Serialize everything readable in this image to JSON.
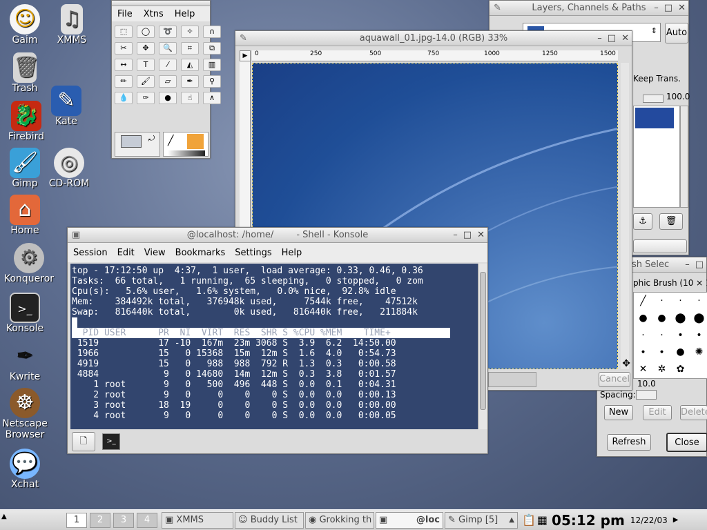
{
  "desktop_icons": [
    {
      "label": "Gaim",
      "icon": "gaim-icon"
    },
    {
      "label": "XMMS",
      "icon": "xmms-icon"
    },
    {
      "label": "Trash",
      "icon": "trash-icon"
    },
    {
      "label": "Kate",
      "icon": "kate-icon"
    },
    {
      "label": "Firebird",
      "icon": "firebird-icon"
    },
    {
      "label": "Gimp",
      "icon": "gimp-icon"
    },
    {
      "label": "CD-ROM",
      "icon": "cdrom-icon"
    },
    {
      "label": "Home",
      "icon": "home-icon"
    },
    {
      "label": "Konqueror",
      "icon": "konqueror-icon"
    },
    {
      "label": "Konsole",
      "icon": "konsole-icon"
    },
    {
      "label": "Kwrite",
      "icon": "kwrite-icon"
    },
    {
      "label": "Netscape Browser",
      "icon": "netscape-icon"
    },
    {
      "label": "Xchat",
      "icon": "xchat-icon"
    }
  ],
  "gimp_toolbox": {
    "menu": [
      "File",
      "Xtns",
      "Help"
    ]
  },
  "layers_window": {
    "title": "Layers, Channels & Paths",
    "auto_label": "Auto",
    "keep_trans": "Keep Trans.",
    "opacity": "100.0"
  },
  "canvas_window": {
    "title": "aquawall_01.jpg-14.0 (RGB) 33%",
    "ruler_ticks": [
      "0",
      "250",
      "500",
      "750",
      "1000",
      "1250",
      "1500"
    ],
    "cancel_label": "Cancel"
  },
  "brush_window": {
    "title": "sh Selec",
    "brush_name": "phic Brush  (10 × 1",
    "size_value": "10.0",
    "spacing_label": "Spacing:",
    "new_label": "New",
    "edit_label": "Edit",
    "delete_label": "Delete",
    "refresh_label": "Refresh",
    "close_label": "Close"
  },
  "konsole": {
    "title": "@localhost: /home/        - Shell - Konsole",
    "menu": [
      "Session",
      "Edit",
      "View",
      "Bookmarks",
      "Settings",
      "Help"
    ],
    "lines": [
      "top - 17:12:50 up  4:37,  1 user,  load average: 0.33, 0.46, 0.36",
      "Tasks:  66 total,   1 running,  65 sleeping,   0 stopped,   0 zom",
      "Cpu(s):   5.6% user,   1.6% system,   0.0% nice,  92.8% idle",
      "Mem:    384492k total,   376948k used,     7544k free,    47512k",
      "Swap:   816440k total,        0k used,   816440k free,   211884k"
    ],
    "header": "  PID USER      PR  NI  VIRT  RES  SHR S %CPU %MEM    TIME+",
    "rows": [
      " 1519           17 -10  167m  23m 3068 S  3.9  6.2  14:50.00",
      " 1966           15   0 15368  15m  12m S  1.6  4.0   0:54.73",
      " 4919           15   0   988  988  792 R  1.3  0.3   0:00.58",
      " 4884            9   0 14680  14m  12m S  0.3  3.8   0:01.57",
      "    1 root       9   0   500  496  448 S  0.0  0.1   0:04.31",
      "    2 root       9   0     0    0    0 S  0.0  0.0   0:00.13",
      "    3 root      18  19     0    0    0 S  0.0  0.0   0:00.00",
      "    4 root       9   0     0    0    0 S  0.0  0.0   0:00.05"
    ]
  },
  "taskbar": {
    "pages": [
      "1",
      "2",
      "3",
      "4"
    ],
    "tasks": [
      "XMMS",
      "Buddy List",
      "Grokking th",
      "@loc",
      "Gimp [5]"
    ],
    "clock": "05:12 pm",
    "date": "12/22/03"
  }
}
